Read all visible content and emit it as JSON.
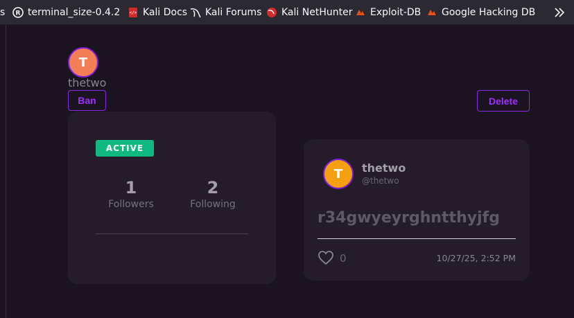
{
  "bookmarks": [
    {
      "label": "s",
      "icon": "none"
    },
    {
      "label": "terminal_size-0.4.2",
      "icon": "rust-icon"
    },
    {
      "label": "Kali Docs",
      "icon": "kali-docs-icon"
    },
    {
      "label": "Kali Forums",
      "icon": "kali-dragon-icon"
    },
    {
      "label": "Kali NetHunter",
      "icon": "nethunter-icon"
    },
    {
      "label": "Exploit-DB",
      "icon": "exploit-db-icon"
    },
    {
      "label": "Google Hacking DB",
      "icon": "ghdb-icon"
    }
  ],
  "profile": {
    "avatar_initial": "T",
    "username": "thetwo",
    "ban_label": "Ban",
    "delete_label": "Delete",
    "status_badge": "ACTIVE",
    "followers_count": "1",
    "followers_label": "Followers",
    "following_count": "2",
    "following_label": "Following"
  },
  "post": {
    "avatar_initial": "T",
    "author_name": "thetwo",
    "author_handle": "@thetwo",
    "text": "r34gwyeyrghntthyjfg",
    "likes": "0",
    "timestamp": "10/27/25, 2:52 PM"
  },
  "colors": {
    "background": "#1b1420",
    "card": "#241c2b",
    "accent_purple": "#8a2be2",
    "active_green": "#10b981",
    "avatar_orange": "#f47e57",
    "post_avatar_orange": "#f5a010"
  }
}
